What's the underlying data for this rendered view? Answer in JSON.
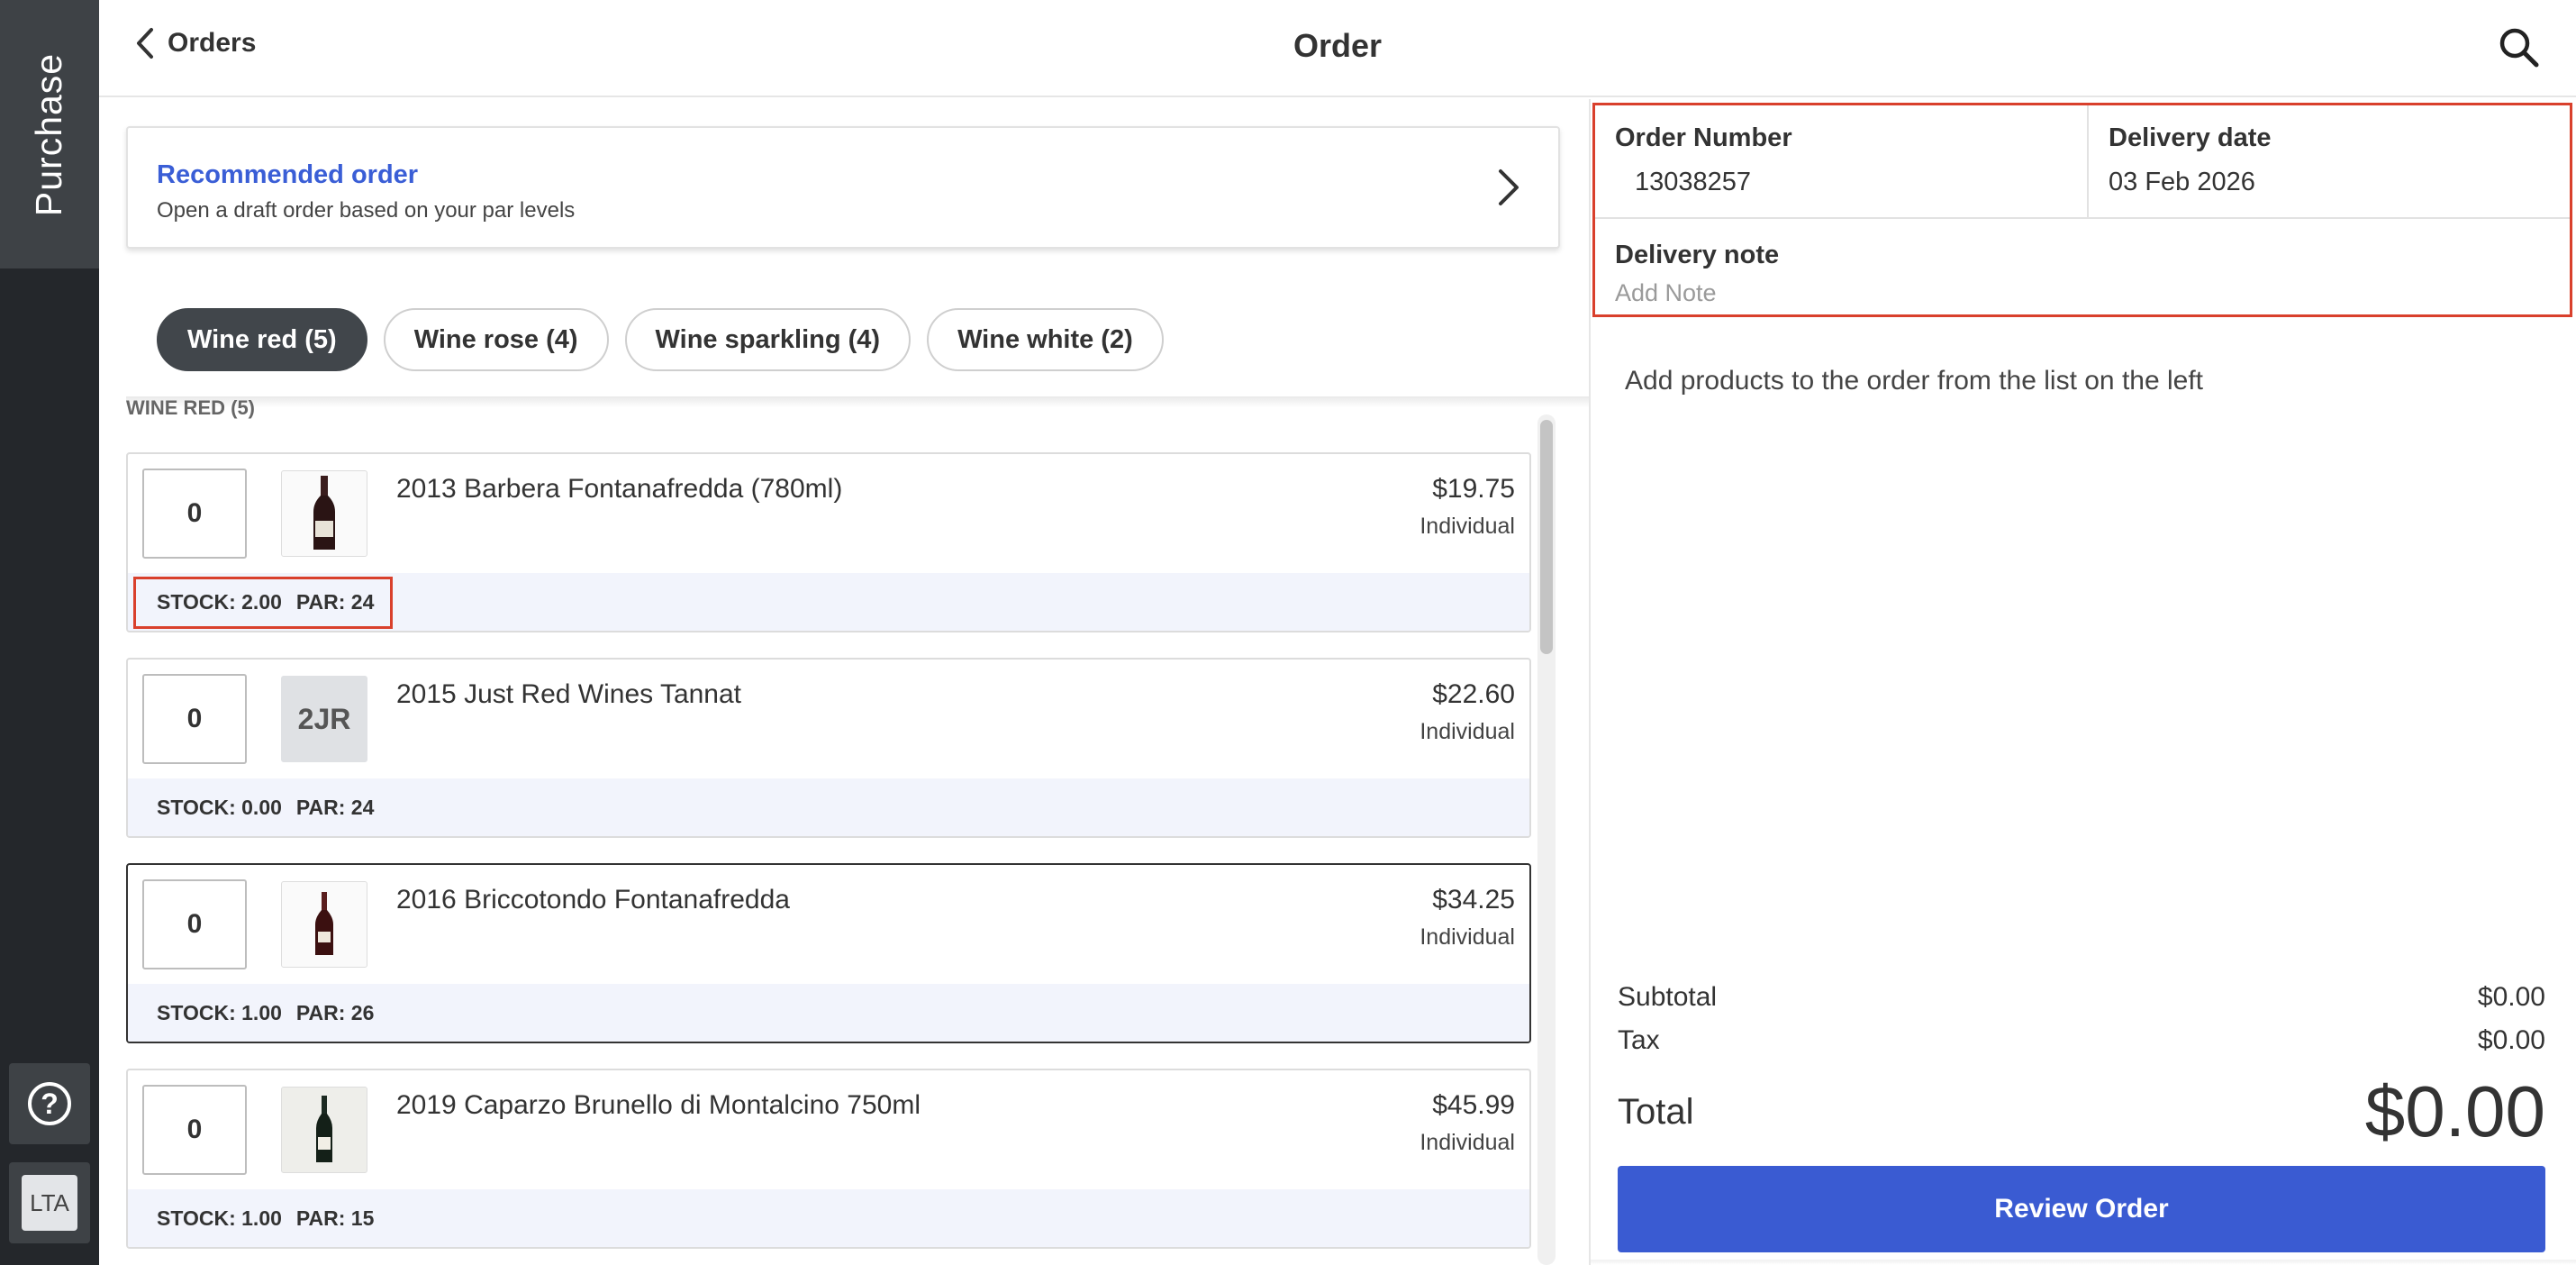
{
  "sidebar": {
    "active_tab": "Purchase",
    "help_icon": "question-circle-icon",
    "avatar_initials": "LTA"
  },
  "header": {
    "back_label": "Orders",
    "title": "Order",
    "search_icon": "search-icon"
  },
  "recommended": {
    "title": "Recommended order",
    "subtitle": "Open a draft order based on your par levels"
  },
  "filters": [
    {
      "label": "Wine red (5)",
      "active": true
    },
    {
      "label": "Wine rose (4)",
      "active": false
    },
    {
      "label": "Wine sparkling (4)",
      "active": false
    },
    {
      "label": "Wine white (2)",
      "active": false
    }
  ],
  "section_label": "WINE RED (5)",
  "items": [
    {
      "qty": "0",
      "thumb": "bottle",
      "name": "2013 Barbera Fontanafredda (780ml)",
      "price": "$19.75",
      "unit": "Individual",
      "stock": "STOCK: 2.00",
      "par": "PAR: 24"
    },
    {
      "qty": "0",
      "thumb": "2JR",
      "name": "2015 Just Red Wines Tannat",
      "price": "$22.60",
      "unit": "Individual",
      "stock": "STOCK: 0.00",
      "par": "PAR: 24"
    },
    {
      "qty": "0",
      "thumb": "bottle",
      "name": "2016 Briccotondo Fontanafredda",
      "price": "$34.25",
      "unit": "Individual",
      "stock": "STOCK: 1.00",
      "par": "PAR: 26"
    },
    {
      "qty": "0",
      "thumb": "bottle",
      "name": "2019 Caparzo Brunello di Montalcino 750ml",
      "price": "$45.99",
      "unit": "Individual",
      "stock": "STOCK: 1.00",
      "par": "PAR: 15"
    }
  ],
  "order": {
    "number_label": "Order Number",
    "number_value": "13038257",
    "delivery_date_label": "Delivery date",
    "delivery_date_value": "03 Feb 2026",
    "delivery_note_label": "Delivery note",
    "delivery_note_placeholder": "Add Note",
    "empty_message": "Add products to the order from the list on the left"
  },
  "summary": {
    "subtotal_label": "Subtotal",
    "subtotal_value": "$0.00",
    "tax_label": "Tax",
    "tax_value": "$0.00",
    "total_label": "Total",
    "total_value": "$0.00",
    "review_button": "Review Order"
  },
  "colors": {
    "accent_blue": "#3a5bd2",
    "highlight_red": "#d9402c",
    "sidebar_dark": "#24272b"
  }
}
